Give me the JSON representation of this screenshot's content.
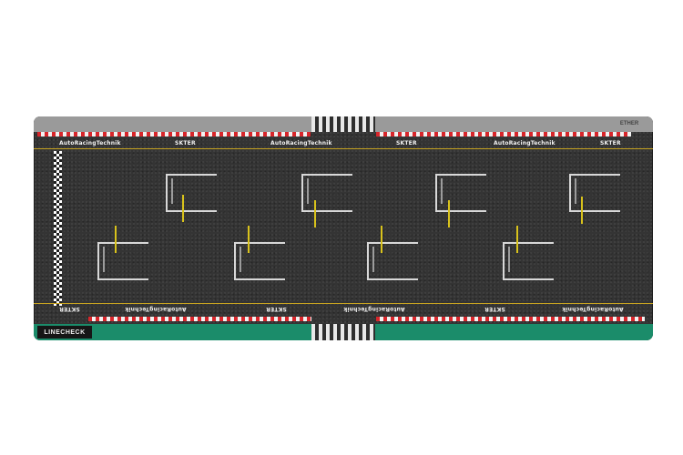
{
  "mat": {
    "name": "race-track-mat",
    "colors": {
      "asphalt": "#343434",
      "top_band": "#9a9a9a",
      "bottom_band": "#1b8c6a",
      "kerb_red": "#d8262b",
      "kerb_white": "#f2f2f2",
      "line_yellow": "#c9a521"
    }
  },
  "top_labels": [
    "AutoRacingTechnik",
    "SKTER",
    "AutoRacingTechnik",
    "SKTER",
    "AutoRacingTechnik",
    "SKTER"
  ],
  "bottom_labels": [
    "AutoRacingTechnik",
    "SKTER",
    "AutoRacingTechnik",
    "SKTER",
    "AutoRacingTechnik",
    "SKTER"
  ],
  "brand_bottom": "LINECHECK",
  "brand_top": "ETHER",
  "grid_slots": 8
}
